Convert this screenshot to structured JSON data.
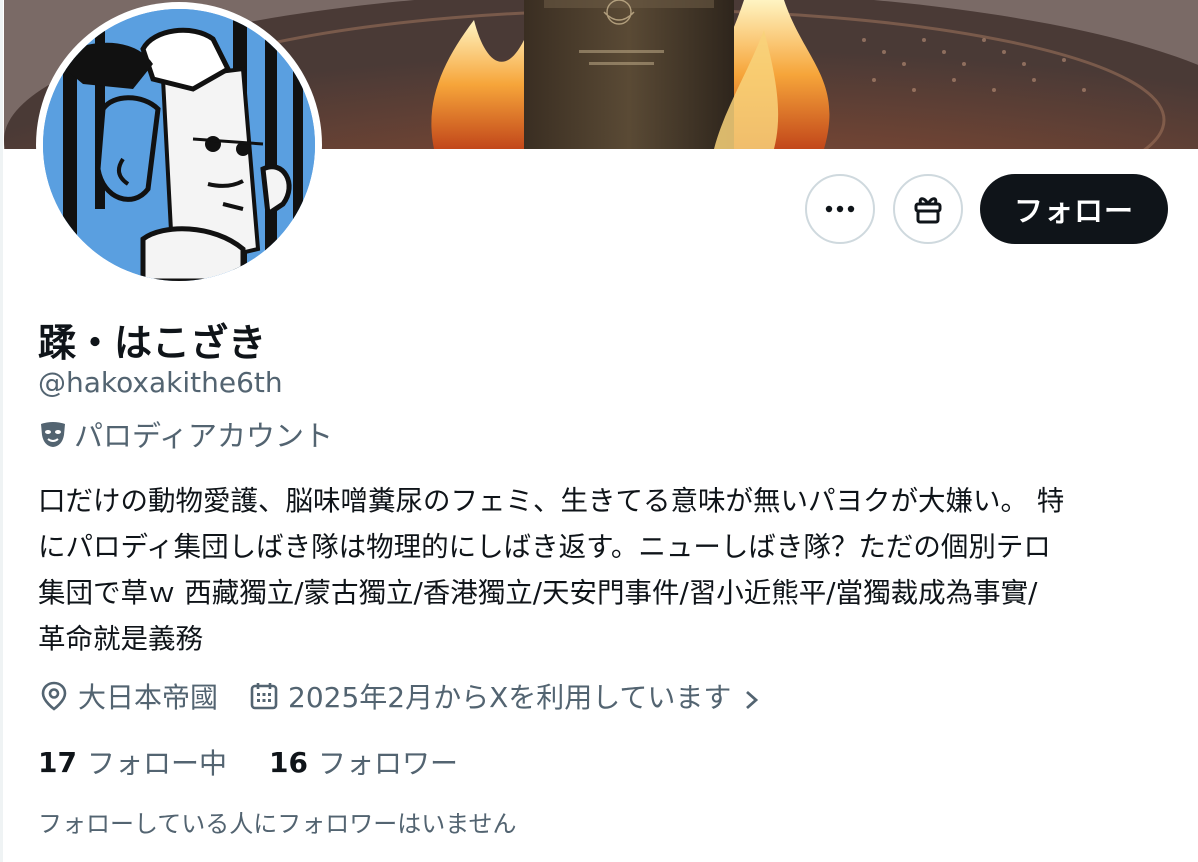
{
  "profile": {
    "display_name": "蹂・はこざき",
    "handle": "@hakoxakithe6th",
    "parody_label": "パロディアカウント",
    "bio_lines": [
      "口だけの動物愛護、脳味噌糞尿のフェミ、生きてる意味が無いパヨクが大嫌い。 特",
      "にパロディ集団しばき隊は物理的にしばき返す。ニューしばき隊？ただの個別テロ",
      "集団で草ｗ 西藏獨立/蒙古獨立/香港獨立/天安門事件/習小近熊平/當獨裁成為事實/",
      "革命就是義務"
    ],
    "location": "大日本帝國",
    "joined": "2025年2月からXを利用しています"
  },
  "stats": {
    "following_count": "17",
    "following_label": "フォロー中",
    "followers_count": "16",
    "followers_label": "フォロワー"
  },
  "followed_by_note": "フォローしている人にフォロワーはいません",
  "actions": {
    "follow_label": "フォロー",
    "more_icon": "more-horizontal-icon",
    "gift_icon": "gift-icon"
  },
  "icons": {
    "parody": "theater-mask-icon",
    "location": "location-pin-icon",
    "calendar": "calendar-icon",
    "chevron": "chevron-right-icon"
  },
  "colors": {
    "text_primary": "#0f1419",
    "text_secondary": "#536471",
    "follow_button_bg": "#0f1419",
    "border": "#cfd9de",
    "avatar_blue": "#5a9fe0"
  }
}
